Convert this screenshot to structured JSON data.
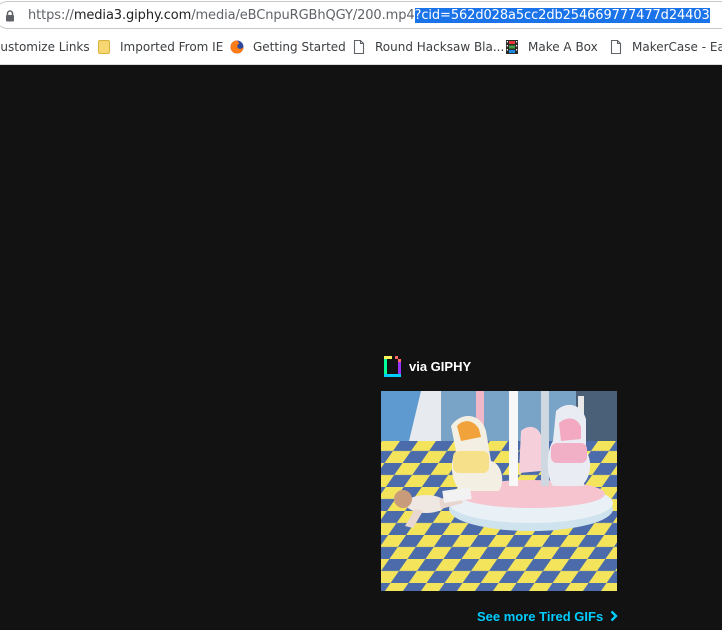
{
  "address_bar": {
    "url_prefix": "https://",
    "url_host": "media3.giphy.com",
    "url_path": "/media/eBCnpuRGBhQGY/200.mp4",
    "url_selected": "?cid=562d028a5cc2db254669777477d24403",
    "icon": "lock-icon"
  },
  "bookmarks": [
    {
      "label": "Customize Links",
      "icon": "none"
    },
    {
      "label": "Imported From IE",
      "icon": "folder-icon",
      "color": "#f7d774"
    },
    {
      "label": "Getting Started",
      "icon": "firefox-icon"
    },
    {
      "label": "Round Hacksaw Bla...",
      "icon": "page-icon"
    },
    {
      "label": "Make A Box",
      "icon": "film-icon"
    },
    {
      "label": "MakerCase - Easy",
      "icon": "page-icon"
    }
  ],
  "giphy": {
    "attribution": "via GIPHY",
    "see_more": "See more Tired GIFs",
    "link_color": "#00ccff"
  }
}
